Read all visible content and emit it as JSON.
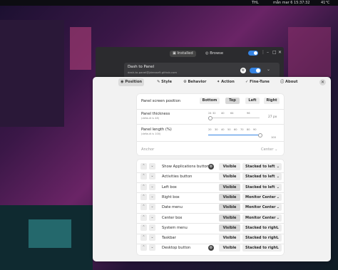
{
  "topbar": {
    "input_method": "THL",
    "datetime": "mån mar 6  15:37:32",
    "temperature": "41°C"
  },
  "ext_manager": {
    "tabs": [
      "Installed",
      "Browse"
    ],
    "extension_name": "Dash to Panel",
    "extension_id": "dash-to-panel@jderose9.github.com"
  },
  "prefs": {
    "tabs": [
      "Position",
      "Style",
      "Behavior",
      "Action",
      "Fine-Tune",
      "About"
    ],
    "active_tab": "Position",
    "panel_position": {
      "label": "Panel screen position",
      "options": [
        "Bottom",
        "Top",
        "Left",
        "Right"
      ],
      "selected": "Top"
    },
    "thickness": {
      "label": "Panel thickness",
      "sub": "(default is 48)",
      "marks": [
        "24",
        "32",
        "40",
        "64",
        "96"
      ],
      "value": "27 px"
    },
    "length": {
      "label": "Panel length (%)",
      "sub": "(default is 100)",
      "marks": [
        "20",
        "30",
        "40",
        "50",
        "60",
        "70",
        "80",
        "90",
        "100"
      ],
      "value": "100"
    },
    "anchor": {
      "label": "Anchor",
      "value": "Center"
    },
    "elements": [
      {
        "name": "Show Applications button",
        "gear": true,
        "visibility": "Visible",
        "position": "Stacked to left"
      },
      {
        "name": "Activities button",
        "gear": false,
        "visibility": "Visible",
        "position": "Stacked to left"
      },
      {
        "name": "Left box",
        "gear": false,
        "visibility": "Visible",
        "position": "Stacked to left"
      },
      {
        "name": "Right box",
        "gear": false,
        "visibility": "Visible",
        "position": "Monitor Center"
      },
      {
        "name": "Date menu",
        "gear": false,
        "visibility": "Visible",
        "position": "Monitor Center"
      },
      {
        "name": "Center box",
        "gear": false,
        "visibility": "Visible",
        "position": "Monitor Center"
      },
      {
        "name": "System menu",
        "gear": false,
        "visibility": "Visible",
        "position": "Stacked to right"
      },
      {
        "name": "Taskbar",
        "gear": false,
        "visibility": "Visible",
        "position": "Stacked to right"
      },
      {
        "name": "Desktop button",
        "gear": true,
        "visibility": "Visible",
        "position": "Stacked to right"
      }
    ]
  }
}
